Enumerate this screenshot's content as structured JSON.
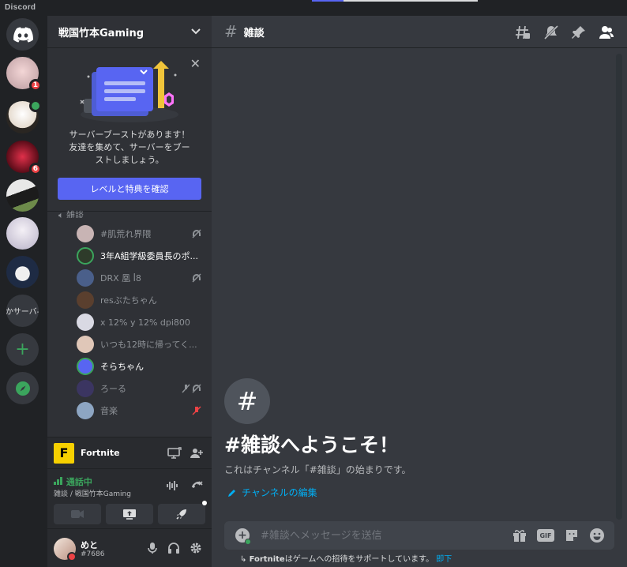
{
  "app": {
    "wordmark": "Discord"
  },
  "colors": {
    "accent": "#5865f2",
    "online": "#3ba55d",
    "danger": "#ed4245",
    "link": "#00aff4"
  },
  "rail": {
    "servers": [
      {
        "name": "home",
        "badge": ""
      },
      {
        "name": "server-1",
        "badge": "1"
      },
      {
        "name": "server-2",
        "badge": ""
      },
      {
        "name": "server-3",
        "badge": "6"
      },
      {
        "name": "server-4",
        "badge": ""
      },
      {
        "name": "server-5",
        "badge": ""
      },
      {
        "name": "server-6",
        "badge": ""
      }
    ],
    "text_server": "かサーバ-"
  },
  "sidebar": {
    "server_name": "戦国竹本Gaming",
    "boost": {
      "text_line1": "サーバーブーストがあります！",
      "text_line2": "友達を集めて、サーバーをブー",
      "text_line3": "ストしましょう。",
      "button": "レベルと特典を確認"
    },
    "voice_channel": "雑談",
    "members": [
      {
        "name": "#肌荒れ界隈",
        "live": false,
        "color": "#c8b4b4"
      },
      {
        "name": "3年A組学級委員長のポ...",
        "live": true,
        "color": "#2e3b2a"
      },
      {
        "name": "DRX 凰 ꟾ8",
        "live": false,
        "color": "#4a5f8a"
      },
      {
        "name": "resぶたちゃん",
        "live": false,
        "color": "#5a3f2e"
      },
      {
        "name": "x 12% y 12% dpi800",
        "live": false,
        "color": "#d9d9e3"
      },
      {
        "name": "いつも12時に帰ってく...",
        "live": false,
        "color": "#e0c7b8"
      },
      {
        "name": "そらちゃん",
        "live": true,
        "color": "#5865f2"
      },
      {
        "name": "ろーる",
        "live": false,
        "color": "#3b3561"
      },
      {
        "name": "音楽",
        "live": false,
        "color": "#8da5c2"
      }
    ],
    "activity": {
      "logo": "F",
      "game": "Fortnite"
    },
    "voice": {
      "status": "通話中",
      "channel": "雑談 / 戦国竹本Gaming"
    },
    "user": {
      "name": "めと",
      "tag": "#7686"
    }
  },
  "main": {
    "channel_name": "雑談",
    "welcome_icon": "#",
    "welcome_title": "#雑談へようこそ！",
    "welcome_desc": "これはチャンネル「#雑談」の始まりです。",
    "edit_link": "チャンネルの編集",
    "composer_placeholder": "#雑談へメッセージを送信",
    "gif_label": "GIF",
    "hint_game": "Fortnite",
    "hint_text": "はゲームへの招待をサポートしています。",
    "hint_link": "即下"
  }
}
